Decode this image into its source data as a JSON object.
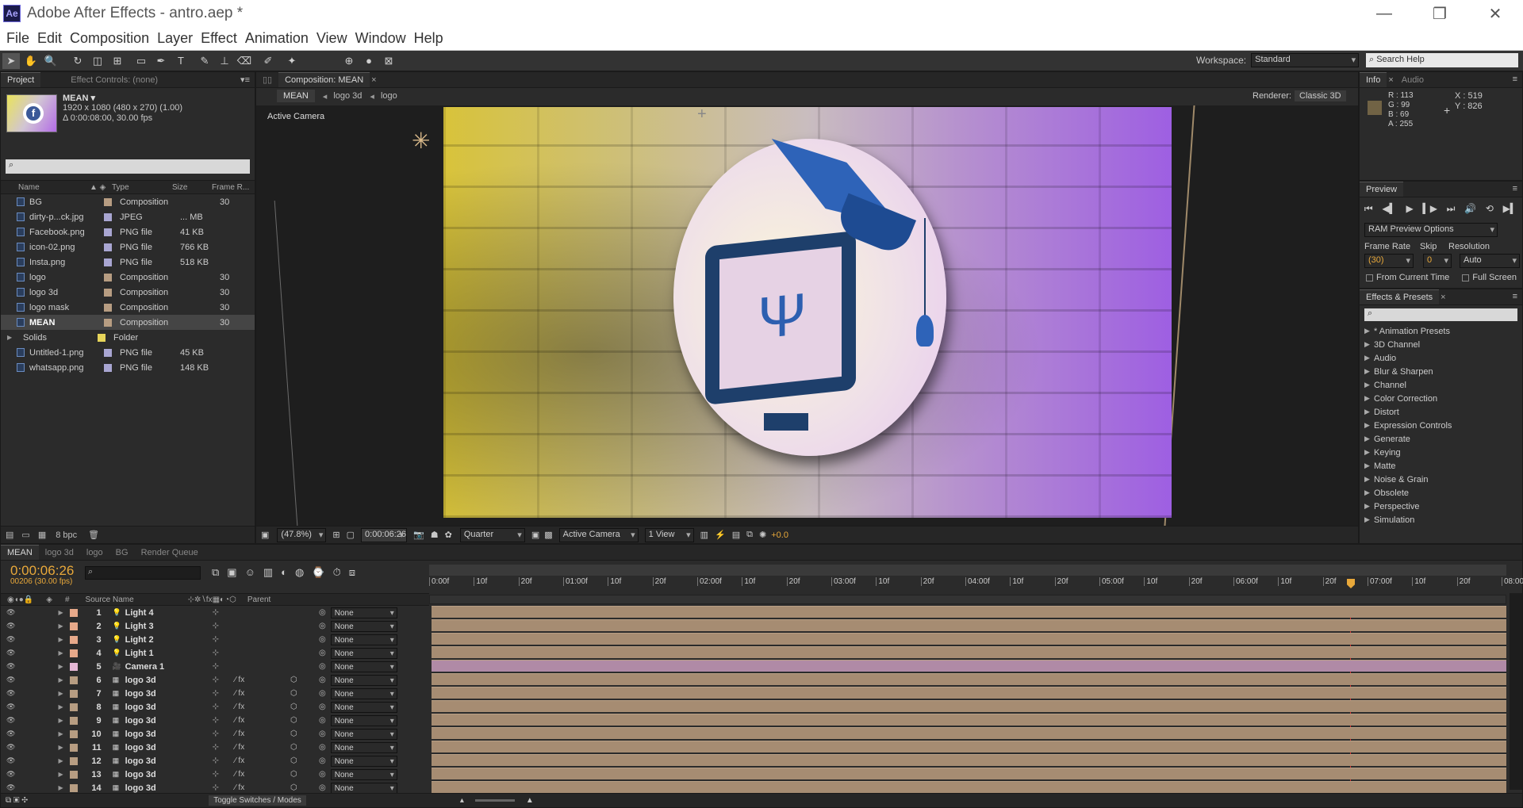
{
  "window": {
    "logo": "Ae",
    "title": "Adobe After Effects - antro.aep *",
    "controls": [
      "—",
      "❐",
      "✕"
    ]
  },
  "menu": [
    "File",
    "Edit",
    "Composition",
    "Layer",
    "Effect",
    "Animation",
    "View",
    "Window",
    "Help"
  ],
  "toolbar": {
    "workspace_label": "Workspace:",
    "workspace_value": "Standard",
    "search_placeholder": "Search Help"
  },
  "project": {
    "tabs": [
      "Project",
      "Effect Controls: (none)"
    ],
    "selected_name": "MEAN ▾",
    "selected_info": [
      "1920 x 1080  (480 x 270) (1.00)",
      "Δ 0:00:08:00, 30.00 fps"
    ],
    "search_icon": "⌕",
    "columns": [
      "Name",
      "Type",
      "Size",
      "Frame R..."
    ],
    "items": [
      {
        "name": "BG",
        "type": "Composition",
        "size": "",
        "fr": "30",
        "color": "#b79d82",
        "kind": "comp"
      },
      {
        "name": "dirty-p...ck.jpg",
        "type": "JPEG",
        "size": "... MB",
        "fr": "",
        "color": "#a9a6d2",
        "kind": "file"
      },
      {
        "name": "Facebook.png",
        "type": "PNG file",
        "size": "41 KB",
        "fr": "",
        "color": "#a9a6d2",
        "kind": "file"
      },
      {
        "name": "icon-02.png",
        "type": "PNG file",
        "size": "766 KB",
        "fr": "",
        "color": "#a9a6d2",
        "kind": "file"
      },
      {
        "name": "Insta.png",
        "type": "PNG file",
        "size": "518 KB",
        "fr": "",
        "color": "#a9a6d2",
        "kind": "file"
      },
      {
        "name": "logo",
        "type": "Composition",
        "size": "",
        "fr": "30",
        "color": "#b79d82",
        "kind": "comp"
      },
      {
        "name": "logo 3d",
        "type": "Composition",
        "size": "",
        "fr": "30",
        "color": "#b79d82",
        "kind": "comp"
      },
      {
        "name": "logo mask",
        "type": "Composition",
        "size": "",
        "fr": "30",
        "color": "#b79d82",
        "kind": "comp"
      },
      {
        "name": "MEAN",
        "type": "Composition",
        "size": "",
        "fr": "30",
        "color": "#b79d82",
        "kind": "comp",
        "selected": true
      },
      {
        "name": "Solids",
        "type": "Folder",
        "size": "",
        "fr": "",
        "color": "#e6d45a",
        "kind": "folder"
      },
      {
        "name": "Untitled-1.png",
        "type": "PNG file",
        "size": "45 KB",
        "fr": "",
        "color": "#a9a6d2",
        "kind": "file"
      },
      {
        "name": "whatsapp.png",
        "type": "PNG file",
        "size": "148 KB",
        "fr": "",
        "color": "#a9a6d2",
        "kind": "file"
      }
    ],
    "bpc": "8 bpc"
  },
  "composition": {
    "tab": "Composition: MEAN",
    "breadcrumbs": [
      "MEAN",
      "logo 3d",
      "logo"
    ],
    "renderer_label": "Renderer:",
    "renderer_value": "Classic 3D",
    "view_label": "Active Camera",
    "zoom": "(47.8%)",
    "timecode": "0:00:06:26",
    "resolution": "Quarter",
    "camera": "Active Camera",
    "views": "1 View",
    "exposure": "+0.0"
  },
  "info": {
    "tabs": [
      "Info",
      "Audio"
    ],
    "r": "R : 113",
    "g": "G : 99",
    "b": "B : 69",
    "a": "A : 255",
    "x": "X : 519",
    "y": "Y : 826",
    "swatch": "#716345"
  },
  "preview": {
    "tab": "Preview",
    "ram_options": "RAM Preview Options",
    "frame_rate_label": "Frame Rate",
    "skip_label": "Skip",
    "resolution_label": "Resolution",
    "frame_rate": "(30)",
    "skip": "0",
    "resolution": "Auto",
    "from_current": "From Current Time",
    "full_screen": "Full Screen"
  },
  "effects": {
    "tab": "Effects & Presets",
    "items": [
      "* Animation Presets",
      "3D Channel",
      "Audio",
      "Blur & Sharpen",
      "Channel",
      "Color Correction",
      "Distort",
      "Expression Controls",
      "Generate",
      "Keying",
      "Matte",
      "Noise & Grain",
      "Obsolete",
      "Perspective",
      "Simulation"
    ]
  },
  "timeline": {
    "tabs": [
      "MEAN",
      "logo 3d",
      "logo",
      "BG",
      "Render Queue"
    ],
    "timecode": "0:00:06:26",
    "frames": "00206 (30.00 fps)",
    "col_hash": "#",
    "col_source": "Source Name",
    "col_parent": "Parent",
    "ruler": [
      "0:00f",
      "10f",
      "20f",
      "01:00f",
      "10f",
      "20f",
      "02:00f",
      "10f",
      "20f",
      "03:00f",
      "10f",
      "20f",
      "04:00f",
      "10f",
      "20f",
      "05:00f",
      "10f",
      "20f",
      "06:00f",
      "10f",
      "20f",
      "07:00f",
      "10f",
      "20f",
      "08:00"
    ],
    "layers": [
      {
        "n": "1",
        "name": "Light 4",
        "type": "light",
        "color": "#e7a98a"
      },
      {
        "n": "2",
        "name": "Light 3",
        "type": "light",
        "color": "#e7a98a"
      },
      {
        "n": "3",
        "name": "Light 2",
        "type": "light",
        "color": "#e7a98a"
      },
      {
        "n": "4",
        "name": "Light 1",
        "type": "light",
        "color": "#e7a98a"
      },
      {
        "n": "5",
        "name": "Camera 1",
        "type": "camera",
        "color": "#e6b8d6"
      },
      {
        "n": "6",
        "name": "logo 3d",
        "type": "comp",
        "color": "#b79d82"
      },
      {
        "n": "7",
        "name": "logo 3d",
        "type": "comp",
        "color": "#b79d82"
      },
      {
        "n": "8",
        "name": "logo 3d",
        "type": "comp",
        "color": "#b79d82"
      },
      {
        "n": "9",
        "name": "logo 3d",
        "type": "comp",
        "color": "#b79d82"
      },
      {
        "n": "10",
        "name": "logo 3d",
        "type": "comp",
        "color": "#b79d82"
      },
      {
        "n": "11",
        "name": "logo 3d",
        "type": "comp",
        "color": "#b79d82"
      },
      {
        "n": "12",
        "name": "logo 3d",
        "type": "comp",
        "color": "#b79d82"
      },
      {
        "n": "13",
        "name": "logo 3d",
        "type": "comp",
        "color": "#b79d82"
      },
      {
        "n": "14",
        "name": "logo 3d",
        "type": "comp",
        "color": "#b79d82"
      }
    ],
    "parent_value": "None",
    "toggle_label": "Toggle Switches / Modes"
  }
}
